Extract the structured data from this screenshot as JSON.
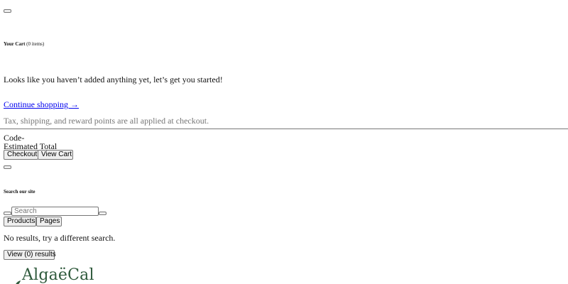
{
  "cart": {
    "heading": "Your Cart",
    "count_label": "(0 items)",
    "empty_message": "Looks like you haven’t added anything yet, let’s get you started!",
    "continue_link": "Continue shopping →",
    "checkout_note": "Tax, shipping, and reward points are all applied at checkout.",
    "code_label": "Code-",
    "estimated_total_label": "Estimated Total",
    "checkout_button": "Checkout",
    "view_cart_button": "View Cart"
  },
  "search": {
    "heading": "Search our site",
    "placeholder": "Search",
    "value": "",
    "tabs": [
      {
        "label": "Products"
      },
      {
        "label": "Pages"
      }
    ],
    "no_results": "No results, try a different search.",
    "view_results_button": "View (0) results"
  },
  "brand": {
    "logo_text": "AlgaëCal",
    "logo_color": "#2f5a3c"
  },
  "icons": {
    "cart_close": "close-icon",
    "search_close": "close-icon",
    "search_submit": "search-icon",
    "search_clear": "clear-icon"
  }
}
